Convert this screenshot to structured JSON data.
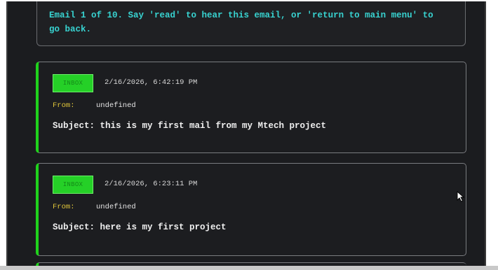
{
  "instruction": {
    "text": "Email 1 of 10. Say 'read' to hear this email, or 'return to main menu' to go back."
  },
  "emails": [
    {
      "folder_badge": "INBOX",
      "timestamp": "2/16/2026, 6:42:19 PM",
      "from_label": "From:",
      "from_value": "undefined",
      "subject_text": "Subject: this is my first mail from my Mtech project"
    },
    {
      "folder_badge": "INBOX",
      "timestamp": "2/16/2026, 6:23:11 PM",
      "from_label": "From:",
      "from_value": "undefined",
      "subject_text": "Subject: here is my first project"
    }
  ],
  "colors": {
    "background": "#1b1c1f",
    "instruction_text": "#38d3d1",
    "accent_green": "#20d21c",
    "from_label": "#e0c63a"
  },
  "icons": {
    "cursor": "mouse-pointer-icon"
  }
}
